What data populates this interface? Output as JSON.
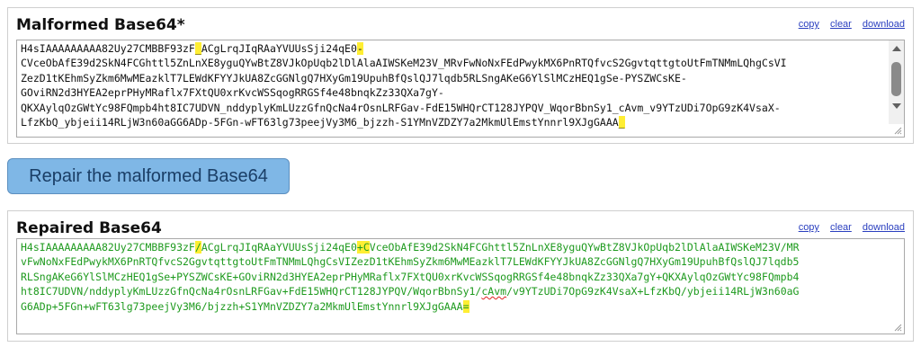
{
  "malformed": {
    "title": "Malformed Base64*",
    "links": {
      "copy": "copy",
      "clear": "clear",
      "download": "download"
    },
    "lines": [
      [
        [
          "H4sIAAAAAAAAA82Uy27CMBBF93zF",
          0
        ],
        [
          "_",
          1
        ],
        [
          "ACgLrqJIqRAaYVUUsSji24qE0",
          0
        ],
        [
          "-",
          1
        ]
      ],
      [
        [
          "CVceObAfE39d2SkN4FCGhttl5ZnLnXE8yguQYwBtZ8VJkOpUqb2lDlAlaAIWSKeM23V_MRvFwNoNxFEdPwykMX6PnRTQfvcS2GgvtqttgtoUtFmTNMmLQhgCsVI",
          0
        ]
      ],
      [
        [
          "ZezD1tKEhmSyZkm6MwMEazklT7LEWdKFYYJkUA8ZcGGNlgQ7HXyGm19UpuhBfQslQJ7lqdb5RLSngAKeG6YlSlMCzHEQ1gSe-PYSZWCsKE-",
          0
        ]
      ],
      [
        [
          "GOviRN2d3HYEA2eprPHyMRaflx7FXtQU0xrKvcWSSqogRRGSf4e48bnqkZz33QXa7gY-",
          0
        ]
      ],
      [
        [
          "QKXAylqOzGWtYc98FQmpb4ht8IC7UDVN_nddyplyKmLUzzGfnQcNa4rOsnLRFGav-FdE15WHQrCT128JYPQV_WqorBbnSy1_cAvm_v9YTzUDi7OpG9zK4VsaX-",
          0
        ]
      ],
      [
        [
          "LfzKbQ_ybjeii14RLjW3n60aGG6ADp-5FGn-wFT63lg73peejVy3M6_bjzzh-S1YMnVZDZY7a2MkmUlEmstYnnrl9XJgGAAA",
          0
        ],
        [
          "_",
          1
        ]
      ]
    ]
  },
  "repair_button": {
    "label": "Repair the malformed Base64"
  },
  "repaired": {
    "title": "Repaired Base64",
    "links": {
      "copy": "copy",
      "clear": "clear",
      "download": "download"
    },
    "lines": [
      [
        [
          "H4sIAAAAAAAAA82Uy27CMBBF93zF",
          0
        ],
        [
          "/",
          1
        ],
        [
          "ACgLrqJIqRAaYVUUsSji24qE0",
          0
        ],
        [
          "+C",
          1
        ],
        [
          "VceObAfE39d2SkN4FCGhttl5ZnLnXE8yguQYwBtZ8VJkOpUqb2lDlAlaAIWSKeM23V/MR",
          0
        ]
      ],
      [
        [
          "vFwNoNxFEdPwykMX6PnRTQfvcS2GgvtqttgtoUtFmTNMmLQhgCsVIZezD1tKEhmSyZkm6MwMEazklT7LEWdKFYYJkUA8ZcGGNlgQ7HXyGm19UpuhBfQslQJ7lqdb5",
          0
        ]
      ],
      [
        [
          "RLSngAKeG6YlSlMCzHEQ1gSe+PYSZWCsKE+GOviRN2d3HYEA2eprPHyMRaflx7FXtQU0xrKvcWSSqogRRGSf4e48bnqkZz33QXa7gY+QKXAylqOzGWtYc98FQmpb4",
          0
        ]
      ],
      [
        [
          "ht8IC7UDVN/nddyplyKmLUzzGfnQcNa4rOsnLRFGav+FdE15WHQrCT128JYPQV/WqorBbnSy1/",
          0
        ],
        [
          "cAvm",
          2
        ],
        [
          "/v9YTzUDi7OpG9zK4VsaX+LfzKbQ/ybjeii14RLjW3n60aG",
          0
        ]
      ],
      [
        [
          "G6ADp+5FGn+wFT63lg73peejVy3M6/bjzzh+S1YMnVZDZY7a2MkmUlEmstYnnrl9XJgGAAA",
          0
        ],
        [
          "=",
          1
        ]
      ]
    ]
  }
}
